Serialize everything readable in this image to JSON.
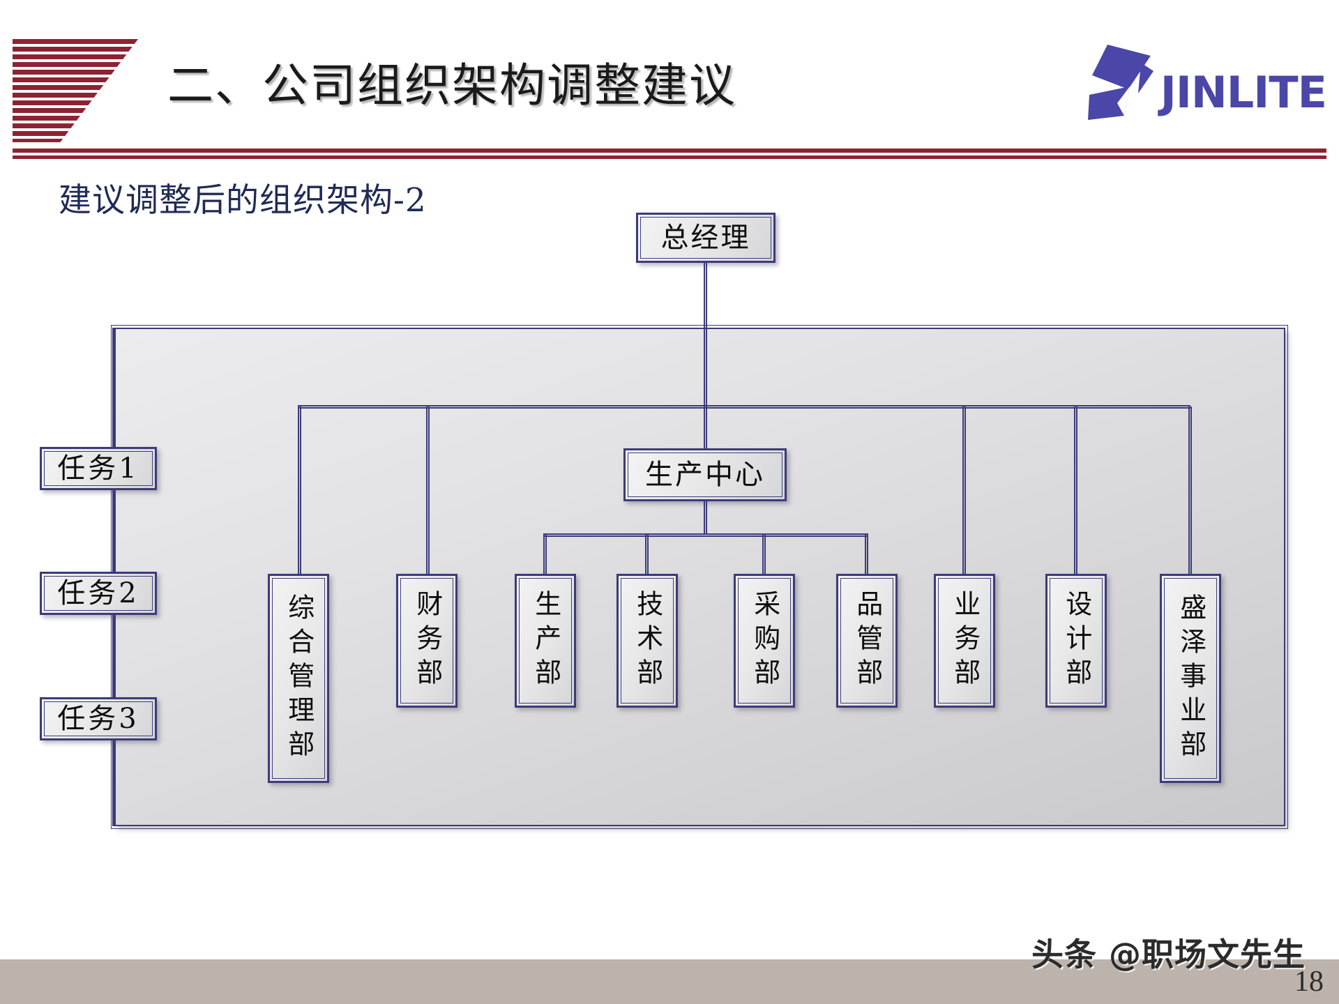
{
  "slide": {
    "title": "二、公司组织架构调整建议",
    "subtitle": "建议调整后的组织架构-2",
    "page_number": "18",
    "watermark": "头条 @职场文先生"
  },
  "brand": {
    "name": "JINLITE",
    "logo_icon": "jinlite-butterfly-logo",
    "accent_color": "#4a47a8",
    "rule_color": "#8f2232"
  },
  "chart_data": {
    "type": "diagram",
    "title": "建议调整后的组织架构-2",
    "root": {
      "label": "总经理"
    },
    "mid": {
      "label": "生产中心"
    },
    "tasks": [
      {
        "label": "任务1"
      },
      {
        "label": "任务2"
      },
      {
        "label": "任务3"
      }
    ],
    "departments": [
      {
        "label": "综合管理部",
        "parent": "总经理"
      },
      {
        "label": "财务部",
        "parent": "总经理"
      },
      {
        "label": "生产部",
        "parent": "生产中心"
      },
      {
        "label": "技术部",
        "parent": "生产中心"
      },
      {
        "label": "采购部",
        "parent": "生产中心"
      },
      {
        "label": "品管部",
        "parent": "生产中心"
      },
      {
        "label": "业务部",
        "parent": "总经理"
      },
      {
        "label": "设计部",
        "parent": "总经理"
      },
      {
        "label": "盛泽事业部",
        "parent": "总经理"
      }
    ],
    "node_border_color": "#3b3b7a",
    "node_fill": "#e9e9ea",
    "panel_fill": "#d9d9dc"
  }
}
